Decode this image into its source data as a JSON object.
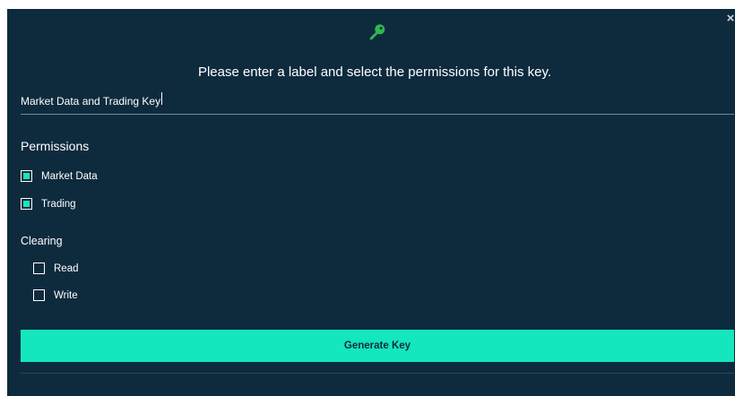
{
  "dialog": {
    "close_glyph": "×",
    "key_icon": "key-icon",
    "prompt": "Please enter a label and select the permissions for this key.",
    "label_input": {
      "value": "Market Data and Trading Key",
      "placeholder": ""
    },
    "permissions": {
      "heading": "Permissions",
      "items": [
        {
          "label": "Market Data",
          "checked": true
        },
        {
          "label": "Trading",
          "checked": true
        }
      ]
    },
    "clearing": {
      "heading": "Clearing",
      "items": [
        {
          "label": "Read",
          "checked": false
        },
        {
          "label": "Write",
          "checked": false
        }
      ]
    },
    "generate_label": "Generate Key"
  },
  "colors": {
    "background": "#0e2b3e",
    "accent": "#14e6bd",
    "key_icon": "#2fb84f",
    "divider": "#5f8fa0"
  }
}
